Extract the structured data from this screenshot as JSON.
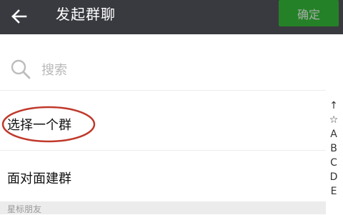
{
  "header": {
    "title": "发起群聊",
    "confirm_label": "确定"
  },
  "search": {
    "placeholder": "搜索"
  },
  "menu": {
    "select_group": "选择一个群",
    "face_to_face": "面对面建群"
  },
  "section": {
    "header": "星标朋友"
  },
  "index": {
    "items": [
      "↑",
      "☆",
      "A",
      "B",
      "C",
      "D",
      "E"
    ]
  },
  "colors": {
    "topbar": "#393a3f",
    "confirm": "#1aad19",
    "annotation_circle": "#c0392b"
  }
}
